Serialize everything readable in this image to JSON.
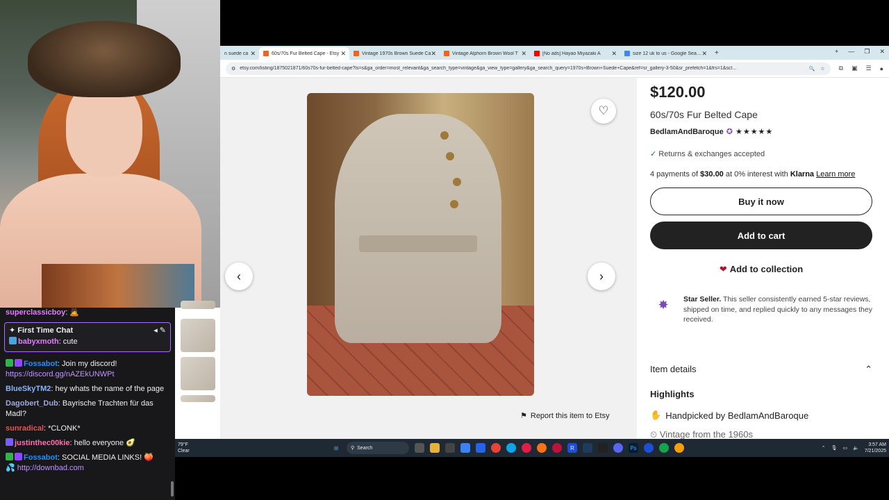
{
  "chat": {
    "top_user": "superclassicboy",
    "first_time_label": "First Time Chat",
    "first_time_user": "babyxmoth",
    "first_time_text": ": cute",
    "messages": [
      {
        "user": "Fossabot",
        "color": "#1e90ff",
        "text": ": Join my discord!",
        "link": "https://discord.gg/nAZEkUNWPt"
      },
      {
        "user": "BlueSkyTM2",
        "color": "#8ab4f8",
        "text": ": hey whats the name of the page"
      },
      {
        "user": "Dagobert_Dub",
        "color": "#9fa8da",
        "text": ": Bayrische Trachten für das Madl?"
      },
      {
        "user": "sunradical",
        "color": "#e6544b",
        "text": ": *CLONK*"
      },
      {
        "user": "justinthec00kie",
        "color": "#ff6fb0",
        "text": ": hello everyone"
      },
      {
        "user": "Fossabot",
        "color": "#1e90ff",
        "text": ": SOCIAL MEDIA LINKS!",
        "link": "http://downbad.com"
      }
    ]
  },
  "browser": {
    "tabs": [
      {
        "title": "n suede ca",
        "fav_color": "#f1641e",
        "active": false
      },
      {
        "title": "60s/70s Fur Belted Cape - Etsy",
        "fav_color": "#f1641e",
        "active": true
      },
      {
        "title": "Vintage 1970s Brown Suede Ca",
        "fav_color": "#f1641e",
        "active": false
      },
      {
        "title": "Vintage Alphorn Brown Wool T",
        "fav_color": "#f1641e",
        "active": false
      },
      {
        "title": "[No ads] Hayao Miyazaki A",
        "fav_color": "#ff0000",
        "active": false
      },
      {
        "title": "size 12 uk to us - Google Search",
        "fav_color": "#4285f4",
        "active": false
      }
    ],
    "url": "etsy.com/listing/1875021871/60s70s-fur-belted-cape?ls=s&ga_order=most_relevant&ga_search_type=vintage&ga_view_type=gallery&ga_search_query=1970s+Brown+Suede+Cape&ref=sr_gallery-3-50&sr_prefetch=1&frs=1&sct..."
  },
  "listing": {
    "price": "$120.00",
    "title": "60s/70s Fur Belted Cape",
    "seller": "BedlamAndBaroque",
    "stars": "★★★★★",
    "returns": "Returns & exchanges accepted",
    "klarna_pre": "4 payments of ",
    "klarna_amount": "$30.00",
    "klarna_mid": " at 0% interest with ",
    "klarna_brand": "Klarna",
    "klarna_link": "Learn more",
    "buy_now": "Buy it now",
    "add_to_cart": "Add to cart",
    "add_to_collection": "Add to collection",
    "star_seller_bold": "Star Seller.",
    "star_seller_text": " This seller consistently earned 5-star reviews, shipped on time, and replied quickly to any messages they received.",
    "item_details": "Item details",
    "highlights": "Highlights",
    "handpicked_pre": "Handpicked by ",
    "handpicked_by": "BedlamAndBaroque",
    "vintage": "Vintage from the 1960s",
    "report": "Report this item to Etsy"
  },
  "taskbar": {
    "temp": "79°F",
    "weather": "Clear",
    "search_placeholder": "Search",
    "time": "3:57 AM",
    "date": "7/21/2025"
  }
}
